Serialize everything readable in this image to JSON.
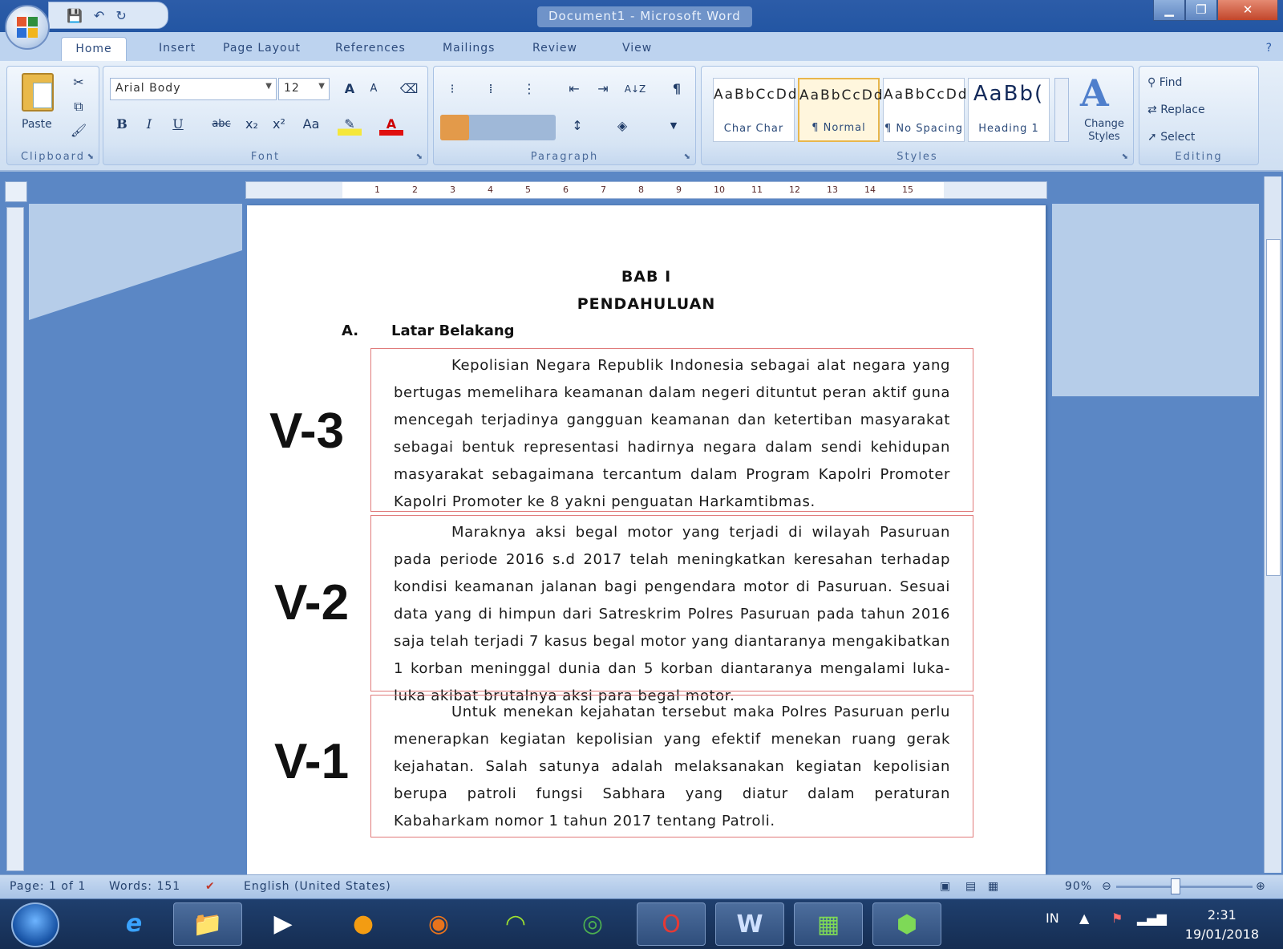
{
  "window": {
    "title": "Document1 - Microsoft Word",
    "quick_access": [
      "save-icon",
      "undo-icon",
      "redo-icon"
    ],
    "controls": {
      "minimize": "▁",
      "maximize": "❐",
      "close": "✕"
    }
  },
  "tabs": {
    "home": "Home",
    "insert": "Insert",
    "page_layout": "Page Layout",
    "references": "References",
    "mailings": "Mailings",
    "review": "Review",
    "view": "View"
  },
  "ribbon": {
    "clipboard": {
      "label": "Clipboard",
      "paste": "Paste"
    },
    "font": {
      "label": "Font",
      "font_name": "Arial Body",
      "font_size": "12",
      "bold": "B",
      "italic": "I",
      "underline": "U",
      "strike": "abc",
      "subscript": "x₂",
      "superscript": "x²",
      "change_case": "Aa",
      "grow": "A",
      "shrink": "A"
    },
    "paragraph": {
      "label": "Paragraph",
      "pilcrow": "¶",
      "sort": "A↓Z"
    },
    "styles": {
      "label": "Styles",
      "items": [
        {
          "sample": "AaBbCcDd",
          "name": "Char Char"
        },
        {
          "sample": "AaBbCcDd",
          "name": "¶ Normal"
        },
        {
          "sample": "AaBbCcDd",
          "name": "¶ No Spacing"
        },
        {
          "sample": "AaBb(",
          "name": "Heading 1"
        }
      ],
      "change_styles": "Change Styles"
    },
    "editing": {
      "label": "Editing",
      "find": "Find",
      "replace": "Replace",
      "select": "Select"
    }
  },
  "ruler": {
    "ticks": [
      "1",
      "2",
      "3",
      "4",
      "5",
      "6",
      "7",
      "8",
      "9",
      "10",
      "11",
      "12",
      "13",
      "14",
      "15"
    ]
  },
  "document": {
    "title1": "BAB I",
    "title2": "PENDAHULUAN",
    "section_letter": "A.",
    "section_title": "Latar Belakang",
    "paragraphs": [
      {
        "label": "V-3",
        "text": "Kepolisian Negara Republik Indonesia sebagai alat negara yang bertugas memelihara keamanan dalam negeri dituntut peran aktif guna mencegah terjadinya gangguan keamanan dan ketertiban masyarakat sebagai bentuk representasi hadirnya negara dalam sendi kehidupan masyarakat sebagaimana tercantum dalam Program Kapolri Promoter Kapolri Promoter ke 8 yakni penguatan Harkamtibmas."
      },
      {
        "label": "V-2",
        "text": "Maraknya aksi begal motor yang terjadi di wilayah Pasuruan pada periode 2016 s.d 2017 telah meningkatkan keresahan terhadap kondisi keamanan jalanan bagi pengendara motor di Pasuruan. Sesuai data yang di himpun dari Satreskrim Polres Pasuruan pada tahun 2016 saja telah terjadi 7 kasus begal motor yang diantaranya mengakibatkan 1 korban meninggal dunia dan 5 korban diantaranya mengalami luka-luka akibat brutalnya aksi para begal motor."
      },
      {
        "label": "V-1",
        "text": "Untuk menekan kejahatan tersebut maka Polres Pasuruan perlu menerapkan kegiatan kepolisian yang efektif menekan ruang gerak kejahatan. Salah satunya adalah melaksanakan kegiatan kepolisian berupa patroli fungsi Sabhara yang diatur dalam peraturan Kabaharkam nomor 1 tahun 2017 tentang Patroli."
      }
    ]
  },
  "status": {
    "page": "Page: 1 of 1",
    "words": "Words: 151",
    "language": "English (United States)",
    "zoom": "90%"
  },
  "taskbar": {
    "clock_time": "2:31",
    "clock_date": "19/01/2018",
    "tray_lang": "IN"
  }
}
